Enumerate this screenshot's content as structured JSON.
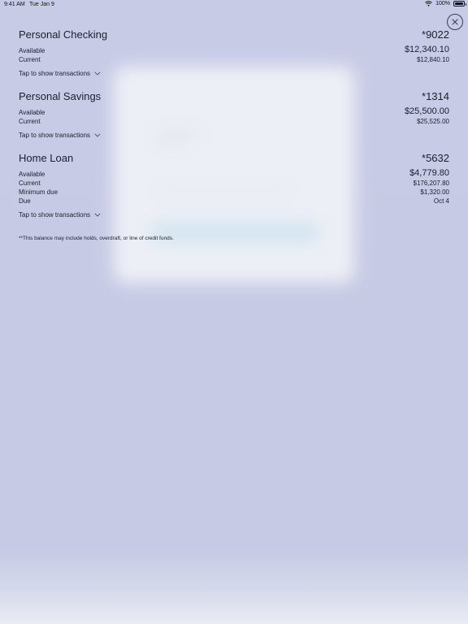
{
  "status_bar": {
    "time": "9:41 AM",
    "date": "Tue Jan 9",
    "battery": "100%"
  },
  "accounts": [
    {
      "name": "Personal Checking",
      "number": "*9022",
      "rows": [
        {
          "label": "Available",
          "value": "$12,340.10"
        },
        {
          "label": "Current",
          "value": "$12,840.10"
        }
      ],
      "tap_label": "Tap to show transactions"
    },
    {
      "name": "Personal Savings",
      "number": "*1314",
      "rows": [
        {
          "label": "Available",
          "value": "$25,500.00"
        },
        {
          "label": "Current",
          "value": "$25,525.00"
        }
      ],
      "tap_label": "Tap to show transactions"
    },
    {
      "name": "Home Loan",
      "number": "*5632",
      "rows": [
        {
          "label": "Available",
          "value": "$4,779.80"
        },
        {
          "label": "Current",
          "value": "$176,207.80"
        },
        {
          "label": "Minimum due",
          "value": "$1,320.00"
        },
        {
          "label": "Due",
          "value": "Oct 4"
        }
      ],
      "tap_label": "Tap to show transactions"
    }
  ],
  "footnote": "**This balance may include holds, overdraft, or line of credit funds.",
  "icons": {
    "close": "close-icon",
    "chevron": "chevron-down-icon",
    "wifi": "wifi-icon",
    "battery": "battery-icon"
  },
  "colors": {
    "background": "#c7cbe4",
    "text": "#1c1f2e",
    "overlay_card": "#f1f3f8"
  }
}
